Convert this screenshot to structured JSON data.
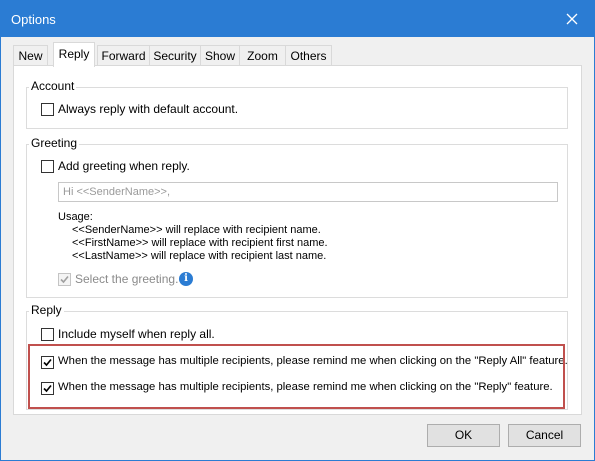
{
  "window": {
    "title": "Options"
  },
  "tabs": [
    {
      "label": "New"
    },
    {
      "label": "Reply"
    },
    {
      "label": "Forward"
    },
    {
      "label": "Security"
    },
    {
      "label": "Show"
    },
    {
      "label": "Zoom"
    },
    {
      "label": "Others"
    }
  ],
  "active_tab": "Reply",
  "account": {
    "group_label": "Account",
    "always_reply_default": {
      "label": "Always reply with default account.",
      "checked": false
    }
  },
  "greeting": {
    "group_label": "Greeting",
    "add_greeting": {
      "label": "Add greeting when reply.",
      "checked": false
    },
    "greeting_input": {
      "value": "Hi <<SenderName>>,"
    },
    "usage_title": "Usage:",
    "usage_lines": [
      "<<SenderName>> will replace with recipient name.",
      "<<FirstName>> will replace with recipient first name.",
      "<<LastName>> will replace with recipient last name."
    ],
    "select_greeting": {
      "label": "Select the greeting.",
      "checked": true,
      "disabled": true
    }
  },
  "reply": {
    "group_label": "Reply",
    "include_myself": {
      "label": "Include myself when reply all.",
      "checked": false
    },
    "remind_reply_all": {
      "label": "When the message has multiple recipients, please remind me when clicking on the \"Reply All\" feature.",
      "checked": true
    },
    "remind_reply": {
      "label": "When the message has multiple recipients, please remind me when clicking on the \"Reply\" feature.",
      "checked": true
    }
  },
  "buttons": {
    "ok": "OK",
    "cancel": "Cancel"
  },
  "colors": {
    "titlebar": "#2b7cd3",
    "highlight": "#c0504d",
    "info_icon": "#2b7cd3"
  }
}
